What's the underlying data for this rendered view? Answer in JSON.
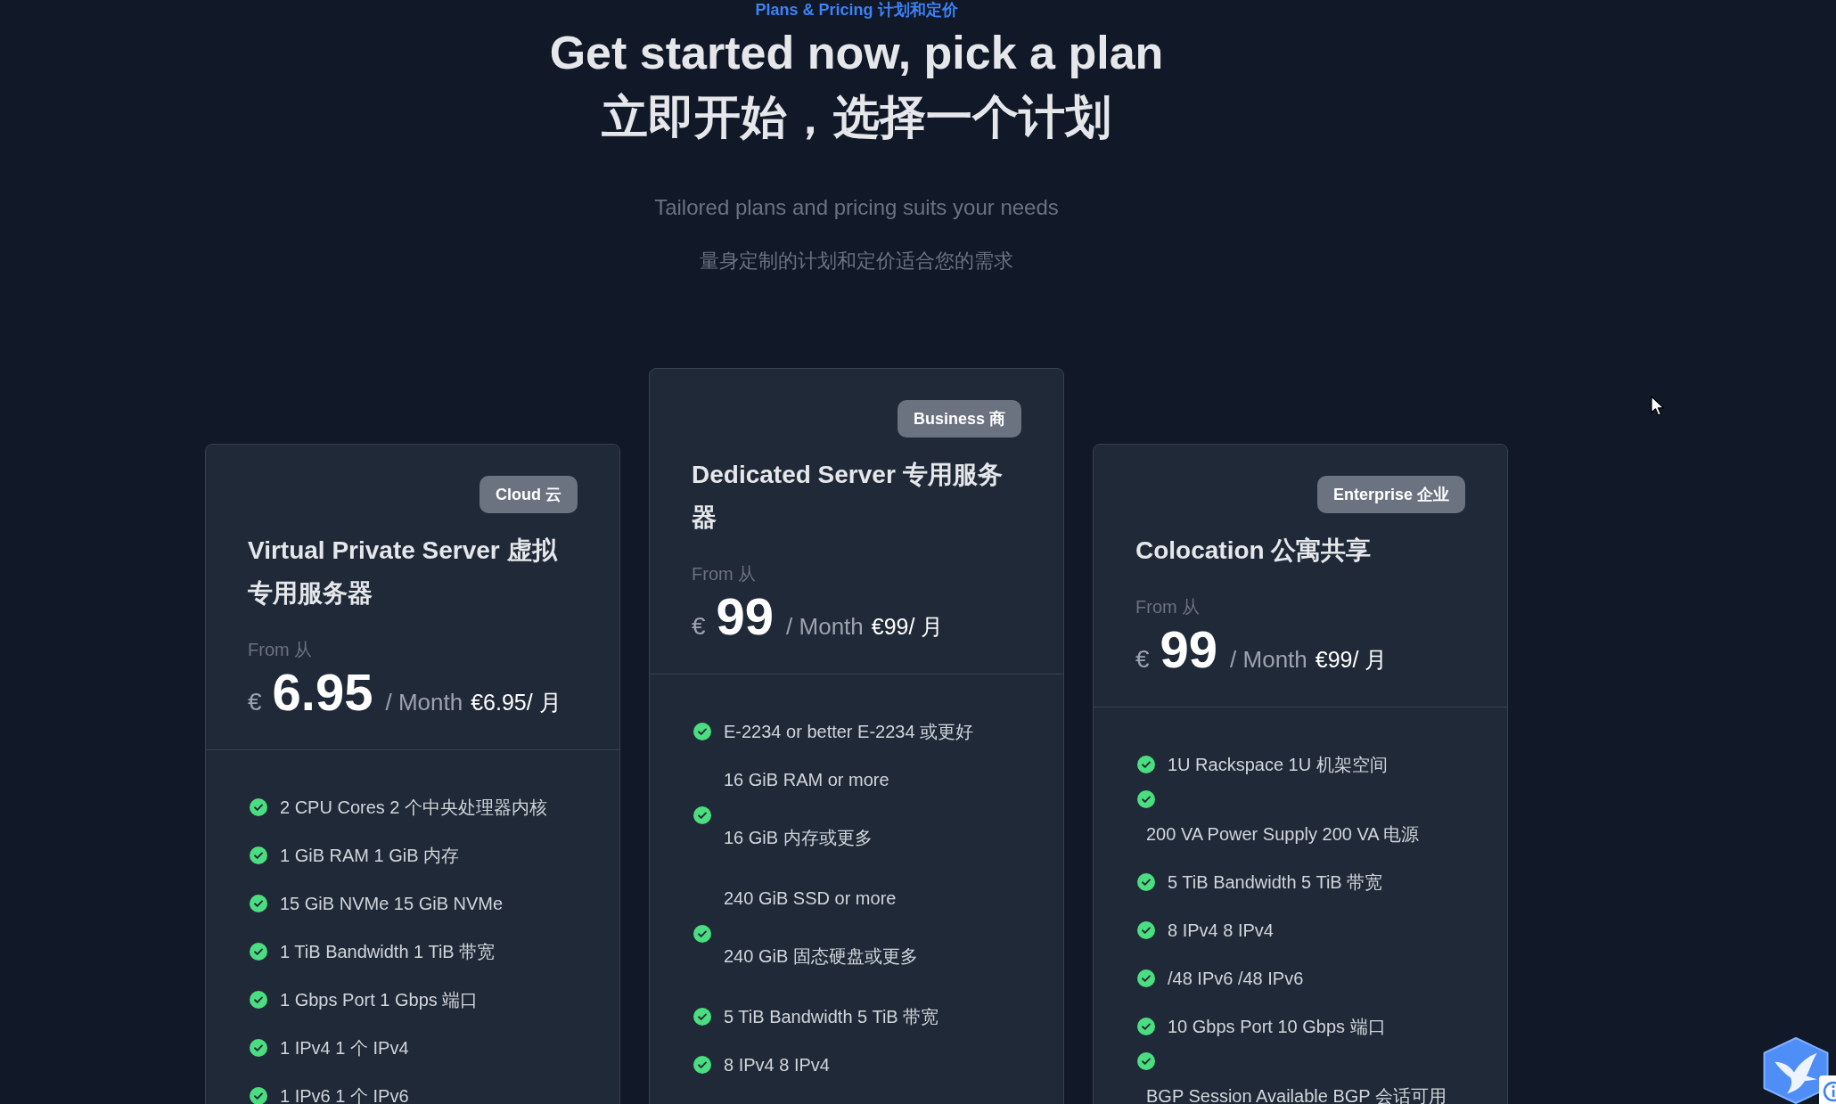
{
  "header": {
    "eyebrow": "Plans & Pricing 计划和定价",
    "title_lines": [
      "Get started now, pick a plan",
      "立即开始，选择一个计划"
    ],
    "subtitle": "Tailored plans and pricing suits your needs",
    "subtitle_2": "量身定制的计划和定价适合您的需求"
  },
  "plans": [
    {
      "featured": false,
      "badge": "Cloud 云",
      "name": "Virtual Private Server 虚拟专用服务器",
      "from": "From 从",
      "currency": "€",
      "price": "6.95",
      "period": "/ Month",
      "period_2": "€6.95/ 月",
      "features": [
        {
          "kind": "inline",
          "text": "2 CPU Cores 2 个中央处理器内核"
        },
        {
          "kind": "inline",
          "text": "1 GiB RAM 1 GiB 内存"
        },
        {
          "kind": "inline",
          "text": "15 GiB NVMe 15 GiB NVMe"
        },
        {
          "kind": "inline",
          "text": "1 TiB Bandwidth 1 TiB 带宽"
        },
        {
          "kind": "inline",
          "text": "1 Gbps Port 1 Gbps 端口"
        },
        {
          "kind": "inline",
          "text": "1 IPv4 1 个 IPv4"
        },
        {
          "kind": "inline",
          "text": "1 IPv6 1 个 IPv6"
        }
      ]
    },
    {
      "featured": true,
      "badge": "Business 商",
      "name": "Dedicated Server 专用服务器",
      "from": "From 从",
      "currency": "€",
      "price": "99",
      "period": "/ Month",
      "period_2": "€99/ 月",
      "features": [
        {
          "kind": "inline",
          "text": "E-2234 or better E-2234 或更好"
        },
        {
          "kind": "two-line",
          "lines": [
            "16 GiB RAM or more",
            "16 GiB 内存或更多"
          ]
        },
        {
          "kind": "two-line",
          "lines": [
            "240 GiB SSD or more",
            "240 GiB 固态硬盘或更多"
          ]
        },
        {
          "kind": "inline",
          "text": "5 TiB Bandwidth 5 TiB 带宽"
        },
        {
          "kind": "inline",
          "text": "8 IPv4 8 IPv4"
        }
      ]
    },
    {
      "featured": false,
      "badge": "Enterprise 企业",
      "name": "Colocation 公寓共享",
      "from": "From 从",
      "currency": "€",
      "price": "99",
      "period": "/ Month",
      "period_2": "€99/ 月",
      "features": [
        {
          "kind": "inline",
          "text": "1U Rackspace 1U 机架空间"
        },
        {
          "kind": "wrapped",
          "text": "200 VA Power Supply 200 VA 电源"
        },
        {
          "kind": "inline",
          "text": "5 TiB Bandwidth 5 TiB 带宽"
        },
        {
          "kind": "inline",
          "text": "8 IPv4 8 IPv4"
        },
        {
          "kind": "inline",
          "text": "/48 IPv6 /48 IPv6"
        },
        {
          "kind": "inline",
          "text": "10 Gbps Port 10 Gbps 端口"
        },
        {
          "kind": "wrapped",
          "text": "BGP Session Available BGP 会话可用"
        }
      ]
    }
  ]
}
